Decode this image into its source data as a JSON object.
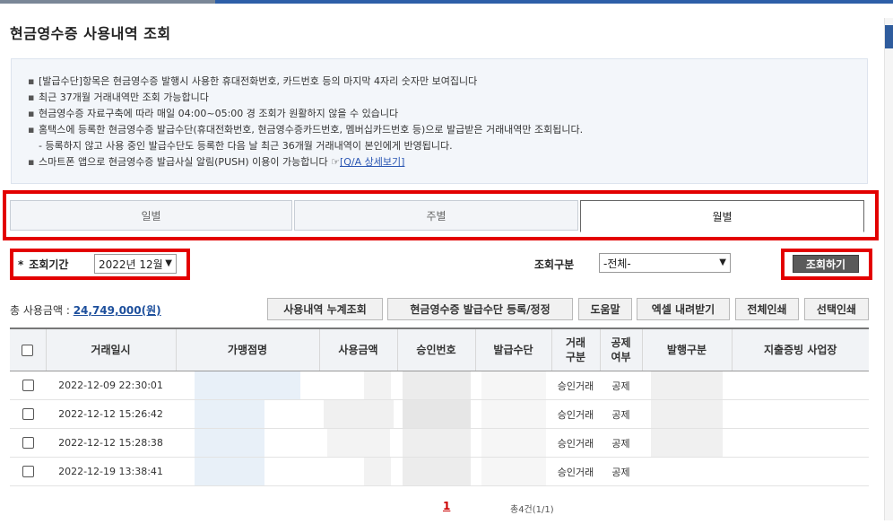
{
  "page": {
    "title": "현금영수증 사용내역 조회"
  },
  "notice": {
    "items": [
      "[발급수단]항목은 현금영수증 발행시 사용한 휴대전화번호, 카드번호 등의 마지막 4자리 숫자만 보여집니다",
      "최근 37개월 거래내역만 조회 가능합니다",
      "현금영수증 자료구축에 따라 매일 04:00~05:00 경 조회가 원활하지 않을 수 있습니다",
      "홈택스에 등록한 현금영수증 발급수단(휴대전화번호, 현금영수증카드번호, 멤버십카드번호 등)으로 발급받은 거래내역만 조회됩니다."
    ],
    "sub_item": "- 등록하지 않고 사용 중인 발급수단도 등록한 다음 날 최근 36개월 거래내역이 본인에게 반영됩니다.",
    "push_item": "스마트폰 앱으로 현금영수증 발급사실 알림(PUSH) 이용이 가능합니다 ☞",
    "push_link": "[Q/A 상세보기]"
  },
  "tabs": [
    {
      "label": "일별"
    },
    {
      "label": "주별"
    },
    {
      "label": "월별"
    }
  ],
  "active_tab": "월별",
  "search": {
    "period_label": "조회기간",
    "period_value": "2022년 12월",
    "type_label": "조회구분",
    "type_value": "-전체-",
    "search_button": "조회하기"
  },
  "summary": {
    "label": "총 사용금액 :",
    "amount": "24,749,000(원)"
  },
  "actions": {
    "cumulative": "사용내역 누계조회",
    "register": "현금영수증 발급수단 등록/정정",
    "help": "도움말",
    "excel": "엑셀 내려받기",
    "print_all": "전체인쇄",
    "print_selected": "선택인쇄"
  },
  "table": {
    "headers": {
      "datetime": "거래일시",
      "merchant": "가맹점명",
      "amount": "사용금액",
      "approval": "승인번호",
      "method": "발급수단",
      "type": "거래\n구분",
      "deduct": "공제\n여부",
      "issue": "발행구분",
      "biz": "지출증빙 사업장"
    },
    "rows": [
      {
        "datetime": "2022-12-09 22:30:01",
        "type": "승인거래",
        "deduct": "공제"
      },
      {
        "datetime": "2022-12-12 15:26:42",
        "type": "승인거래",
        "deduct": "공제"
      },
      {
        "datetime": "2022-12-12 15:28:38",
        "type": "승인거래",
        "deduct": "공제"
      },
      {
        "datetime": "2022-12-19 13:38:41",
        "type": "승인거래",
        "deduct": "공제"
      }
    ]
  },
  "pagination": {
    "current_page": "1",
    "count_text": "총4건(1/1)"
  },
  "colors": {
    "highlight": "#e30000",
    "link": "#1d4f9c",
    "accent": "#2f5c9d"
  }
}
